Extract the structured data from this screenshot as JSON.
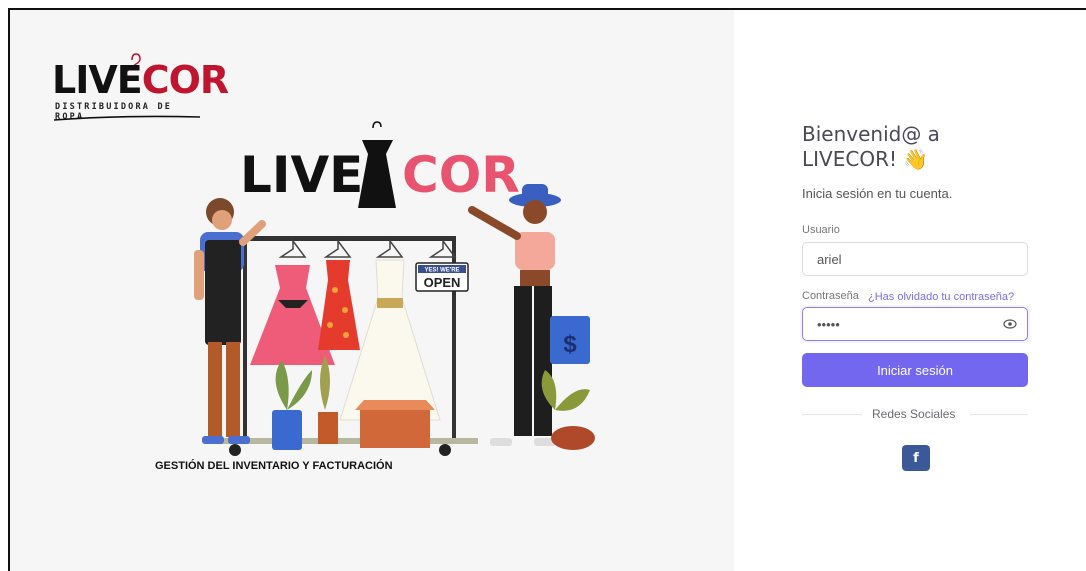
{
  "brand": {
    "logo_word_black": "LIVE",
    "logo_word_red": "COR",
    "logo_subtitle": "DISTRIBUIDORA DE ROPA",
    "big_logo_black": "LIVE",
    "big_logo_pink": "COR",
    "open_sign_top": "YES! WE'RE",
    "open_sign_main": "OPEN",
    "bag_symbol": "$",
    "caption": "GESTIÓN DEL INVENTARIO Y FACTURACIÓN"
  },
  "login": {
    "title_line1": "Bienvenid@ a",
    "title_line2": "LIVECOR!",
    "wave_emoji": "👋",
    "subtitle": "Inicia sesión en tu cuenta.",
    "username_label": "Usuario",
    "username_value": "ariel",
    "password_label": "Contraseña",
    "forgot_link": "¿Has olvidado tu contraseña?",
    "password_value": "•••••",
    "submit_label": "Iniciar sesión",
    "social_label": "Redes Sociales",
    "facebook_glyph": "f"
  },
  "colors": {
    "accent": "#7367f0",
    "logo_red": "#c0152e",
    "logo_pink": "#e8546f",
    "facebook": "#3b5998",
    "left_bg": "#f6f6f6"
  },
  "icons": [
    "eye-icon",
    "facebook-icon",
    "hanger-icon",
    "dress-icon"
  ]
}
